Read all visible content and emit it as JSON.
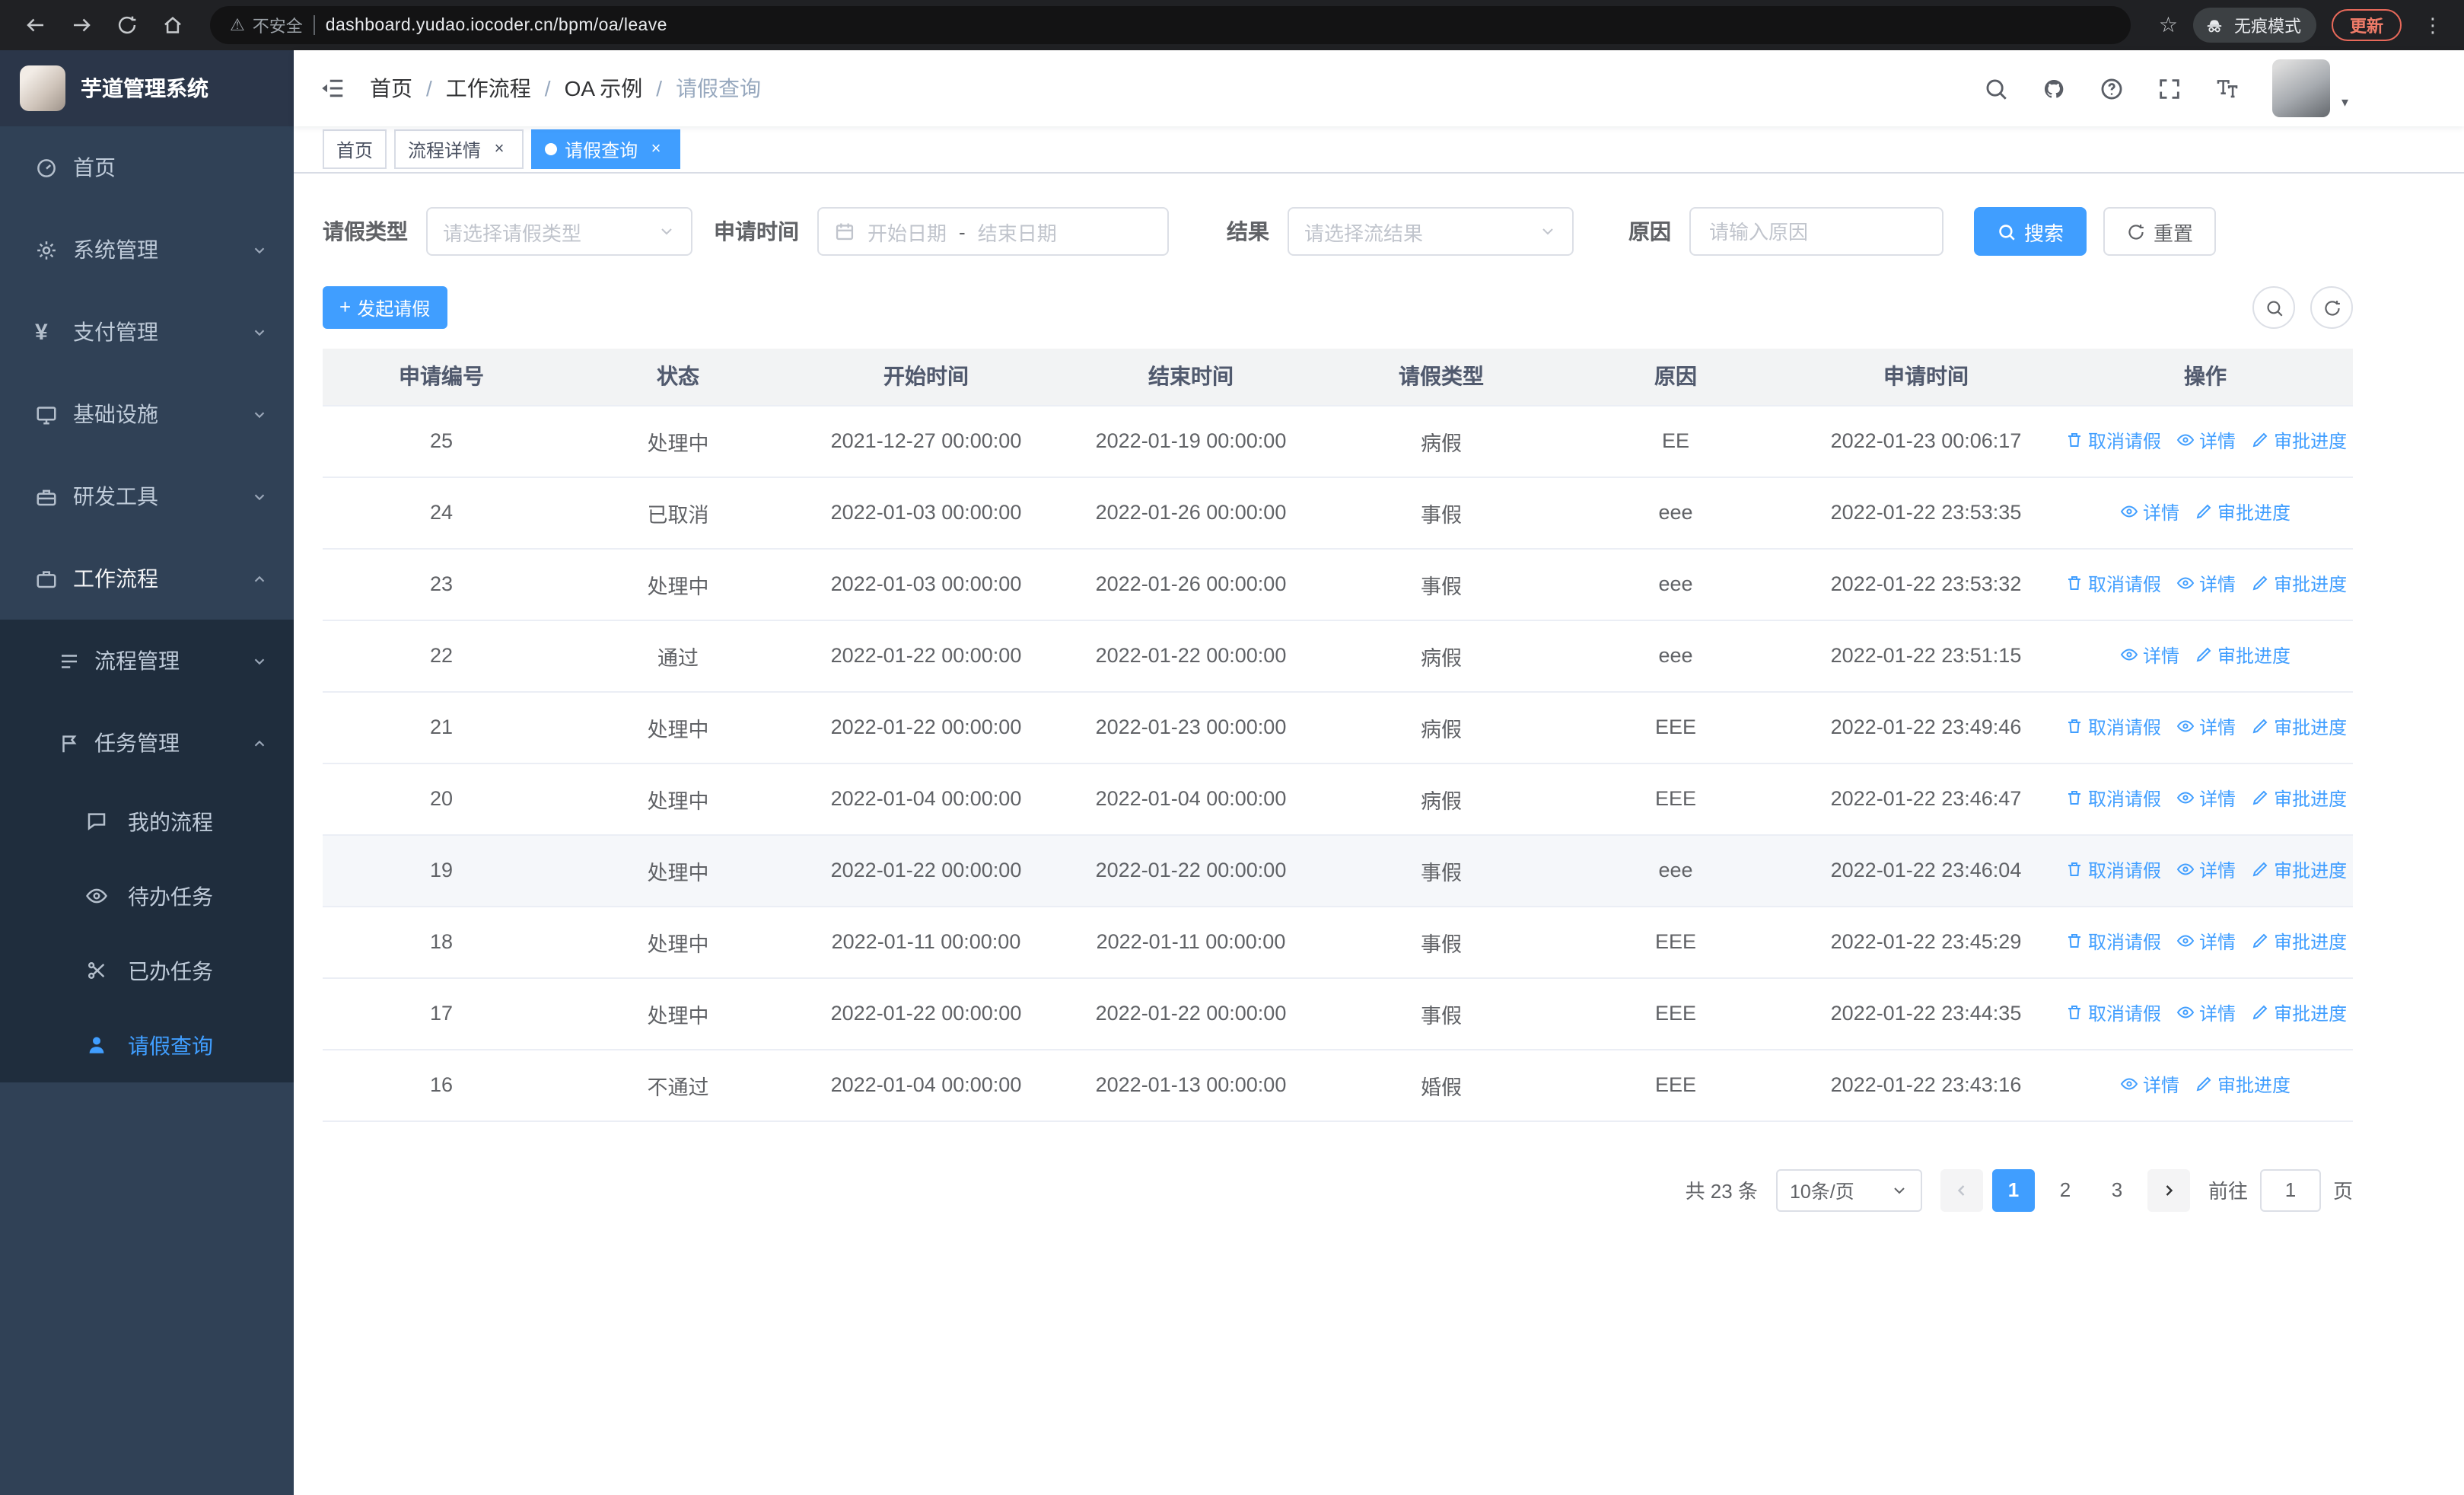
{
  "colors": {
    "primary": "#409eff",
    "sidebar_bg": "#304156",
    "submenu_bg": "#1f2d3d"
  },
  "browser": {
    "security_label": "不安全",
    "url": "dashboard.yudao.iocoder.cn/bpm/oa/leave",
    "incognito_label": "无痕模式",
    "update_label": "更新"
  },
  "sidebar": {
    "logo_title": "芋道管理系统",
    "items": [
      {
        "label": "首页"
      },
      {
        "label": "系统管理"
      },
      {
        "label": "支付管理"
      },
      {
        "label": "基础设施"
      },
      {
        "label": "研发工具"
      },
      {
        "label": "工作流程"
      },
      {
        "label": "流程管理"
      },
      {
        "label": "任务管理"
      },
      {
        "label": "我的流程"
      },
      {
        "label": "待办任务"
      },
      {
        "label": "已办任务"
      },
      {
        "label": "请假查询"
      }
    ]
  },
  "header": {
    "breadcrumb": [
      "首页",
      "工作流程",
      "OA 示例",
      "请假查询"
    ]
  },
  "tabs": [
    {
      "label": "首页"
    },
    {
      "label": "流程详情"
    },
    {
      "label": "请假查询"
    }
  ],
  "filters": {
    "leave_type_label": "请假类型",
    "leave_type_placeholder": "请选择请假类型",
    "apply_time_label": "申请时间",
    "start_date_placeholder": "开始日期",
    "range_separator": "-",
    "end_date_placeholder": "结束日期",
    "result_label": "结果",
    "result_placeholder": "请选择流结果",
    "reason_label": "原因",
    "reason_placeholder": "请输入原因",
    "search_label": "搜索",
    "reset_label": "重置"
  },
  "toolbar": {
    "create_label": "发起请假"
  },
  "table": {
    "columns": [
      "申请编号",
      "状态",
      "开始时间",
      "结束时间",
      "请假类型",
      "原因",
      "申请时间",
      "操作"
    ],
    "action_labels": {
      "cancel": "取消请假",
      "detail": "详情",
      "progress": "审批进度"
    },
    "rows": [
      {
        "id": "25",
        "status": "处理中",
        "start": "2021-12-27 00:00:00",
        "end": "2022-01-19 00:00:00",
        "type": "病假",
        "reason": "EE",
        "apply_time": "2022-01-23 00:06:17",
        "actions": [
          "cancel",
          "detail",
          "progress"
        ]
      },
      {
        "id": "24",
        "status": "已取消",
        "start": "2022-01-03 00:00:00",
        "end": "2022-01-26 00:00:00",
        "type": "事假",
        "reason": "eee",
        "apply_time": "2022-01-22 23:53:35",
        "actions": [
          "detail",
          "progress"
        ]
      },
      {
        "id": "23",
        "status": "处理中",
        "start": "2022-01-03 00:00:00",
        "end": "2022-01-26 00:00:00",
        "type": "事假",
        "reason": "eee",
        "apply_time": "2022-01-22 23:53:32",
        "actions": [
          "cancel",
          "detail",
          "progress"
        ]
      },
      {
        "id": "22",
        "status": "通过",
        "start": "2022-01-22 00:00:00",
        "end": "2022-01-22 00:00:00",
        "type": "病假",
        "reason": "eee",
        "apply_time": "2022-01-22 23:51:15",
        "actions": [
          "detail",
          "progress"
        ]
      },
      {
        "id": "21",
        "status": "处理中",
        "start": "2022-01-22 00:00:00",
        "end": "2022-01-23 00:00:00",
        "type": "病假",
        "reason": "EEE",
        "apply_time": "2022-01-22 23:49:46",
        "actions": [
          "cancel",
          "detail",
          "progress"
        ]
      },
      {
        "id": "20",
        "status": "处理中",
        "start": "2022-01-04 00:00:00",
        "end": "2022-01-04 00:00:00",
        "type": "病假",
        "reason": "EEE",
        "apply_time": "2022-01-22 23:46:47",
        "actions": [
          "cancel",
          "detail",
          "progress"
        ]
      },
      {
        "id": "19",
        "status": "处理中",
        "start": "2022-01-22 00:00:00",
        "end": "2022-01-22 00:00:00",
        "type": "事假",
        "reason": "eee",
        "apply_time": "2022-01-22 23:46:04",
        "actions": [
          "cancel",
          "detail",
          "progress"
        ],
        "hover": true
      },
      {
        "id": "18",
        "status": "处理中",
        "start": "2022-01-11 00:00:00",
        "end": "2022-01-11 00:00:00",
        "type": "事假",
        "reason": "EEE",
        "apply_time": "2022-01-22 23:45:29",
        "actions": [
          "cancel",
          "detail",
          "progress"
        ]
      },
      {
        "id": "17",
        "status": "处理中",
        "start": "2022-01-22 00:00:00",
        "end": "2022-01-22 00:00:00",
        "type": "事假",
        "reason": "EEE",
        "apply_time": "2022-01-22 23:44:35",
        "actions": [
          "cancel",
          "detail",
          "progress"
        ]
      },
      {
        "id": "16",
        "status": "不通过",
        "start": "2022-01-04 00:00:00",
        "end": "2022-01-13 00:00:00",
        "type": "婚假",
        "reason": "EEE",
        "apply_time": "2022-01-22 23:43:16",
        "actions": [
          "detail",
          "progress"
        ]
      }
    ]
  },
  "pagination": {
    "total_label": "共 23 条",
    "page_size": "10条/页",
    "pages": [
      "1",
      "2",
      "3"
    ],
    "active_page": "1",
    "goto_label": "前往",
    "goto_value": "1",
    "page_suffix": "页"
  }
}
